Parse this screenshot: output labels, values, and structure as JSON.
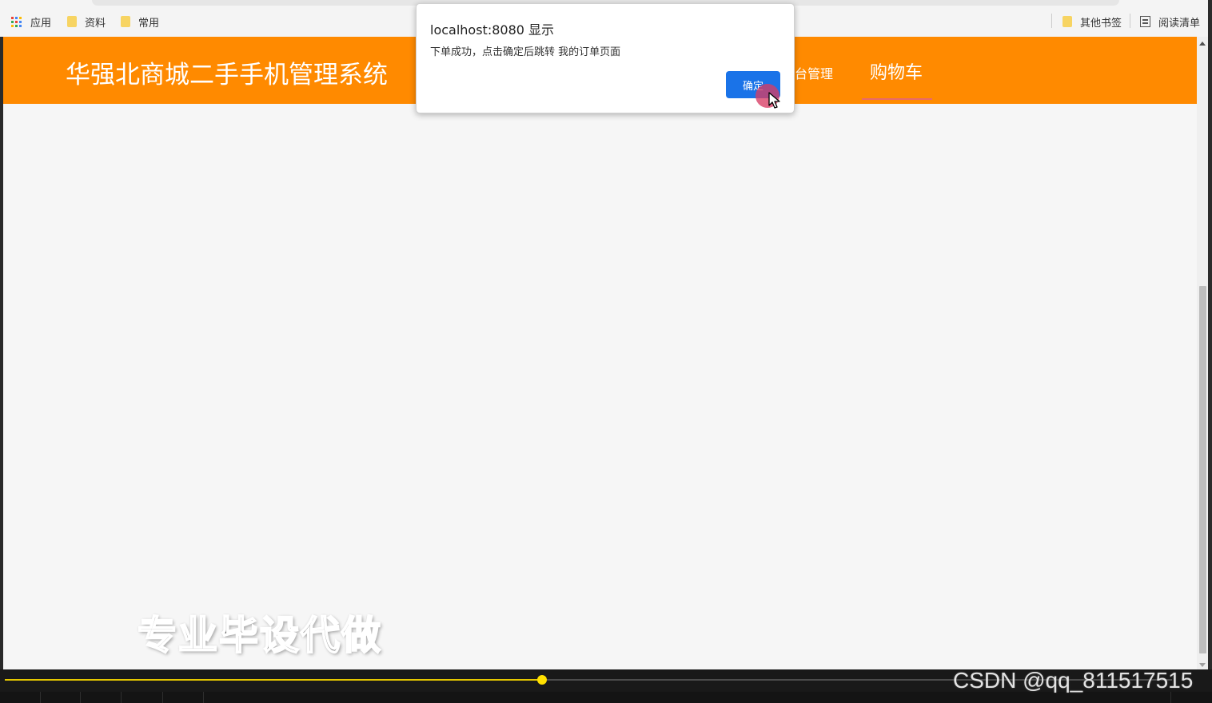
{
  "bookmarks_bar": {
    "items": [
      {
        "label": "应用",
        "icon": "apps-grid-icon"
      },
      {
        "label": "资料",
        "icon": "folder-icon"
      },
      {
        "label": "常用",
        "icon": "folder-icon"
      }
    ],
    "other_bookmarks": {
      "label": "其他书签",
      "icon": "folder-icon"
    },
    "reading_list": {
      "label": "阅读清单",
      "icon": "reading-list-icon"
    }
  },
  "page": {
    "title": "华强北商城二手手机管理系统",
    "nav": {
      "admin_label": "台管理",
      "cart_label": "购物车"
    },
    "watermark": "专业毕设代做"
  },
  "alert": {
    "title": "localhost:8080 显示",
    "message": "下单成功，点击确定后跳转 我的订单页面",
    "ok_label": "确定"
  },
  "video_player": {
    "progress_fraction": 0.46,
    "watermark": "CSDN @qq_811517515"
  },
  "colors": {
    "nav_bg": "#ff8a00",
    "page_bg": "#f6f6f6",
    "ok_button": "#1a73e8",
    "progress": "#ffe000",
    "cart_underline": "#e96a6a"
  }
}
